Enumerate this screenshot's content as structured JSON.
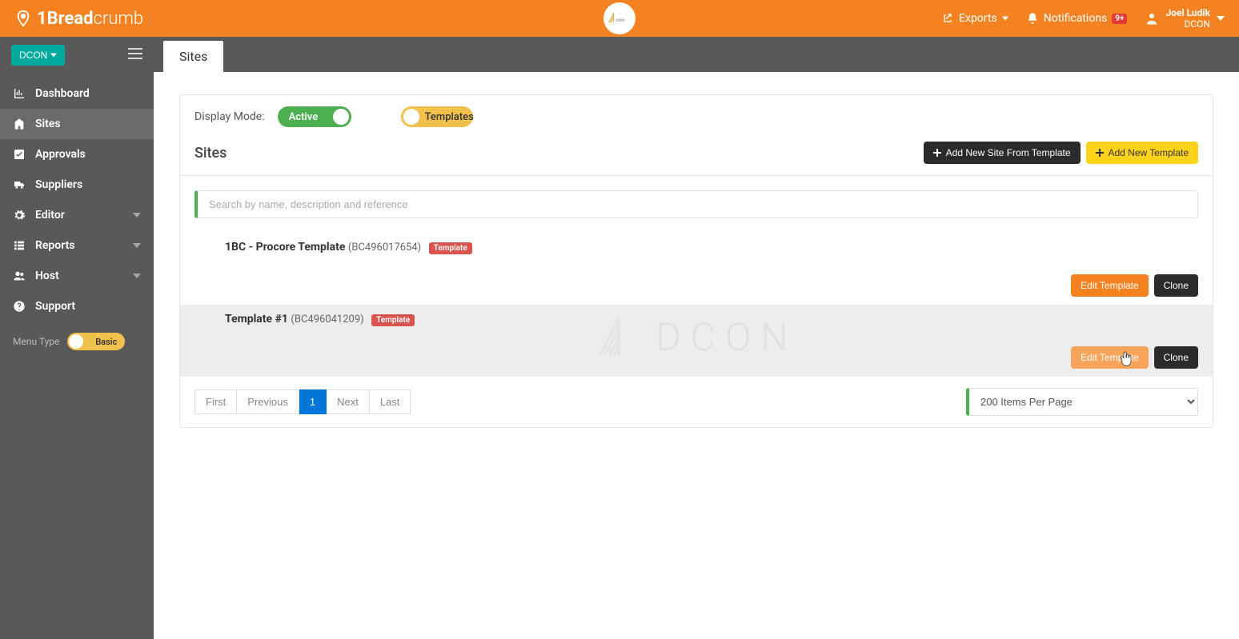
{
  "brand": {
    "text1": "1Bread",
    "text2": "crumb",
    "center_logo": "DCON"
  },
  "topbar": {
    "exports": "Exports",
    "notifications": "Notifications",
    "notif_badge": "9+",
    "user_name": "Joel Ludik",
    "user_org": "DCON"
  },
  "sidebar": {
    "org_button": "DCON",
    "items": [
      {
        "label": "Dashboard",
        "icon": "chart"
      },
      {
        "label": "Sites",
        "icon": "building",
        "active": true
      },
      {
        "label": "Approvals",
        "icon": "check"
      },
      {
        "label": "Suppliers",
        "icon": "truck"
      },
      {
        "label": "Editor",
        "icon": "gear",
        "expandable": true
      },
      {
        "label": "Reports",
        "icon": "list",
        "expandable": true
      },
      {
        "label": "Host",
        "icon": "users",
        "expandable": true
      },
      {
        "label": "Support",
        "icon": "help"
      }
    ],
    "menu_type_label": "Menu Type",
    "menu_type_value": "Basic"
  },
  "page": {
    "tab_title": "Sites",
    "display_mode_label": "Display Mode:",
    "toggle_active": "Active",
    "toggle_templates": "Templates",
    "section_title": "Sites",
    "btn_add_from_template": "Add New Site From Template",
    "btn_add_new_template": "Add New Template",
    "search_placeholder": "Search by name, description and reference",
    "rows": [
      {
        "name": "1BC - Procore Template",
        "ref": "(BC496017654)",
        "tag": "Template",
        "edit": "Edit Template",
        "clone": "Clone"
      },
      {
        "name": "Template #1",
        "ref": "(BC496041209)",
        "tag": "Template",
        "edit": "Edit Template",
        "clone": "Clone"
      }
    ],
    "pagination": {
      "first": "First",
      "prev": "Previous",
      "page": "1",
      "next": "Next",
      "last": "Last",
      "page_size": "200 Items Per Page"
    },
    "watermark": "DCON"
  }
}
